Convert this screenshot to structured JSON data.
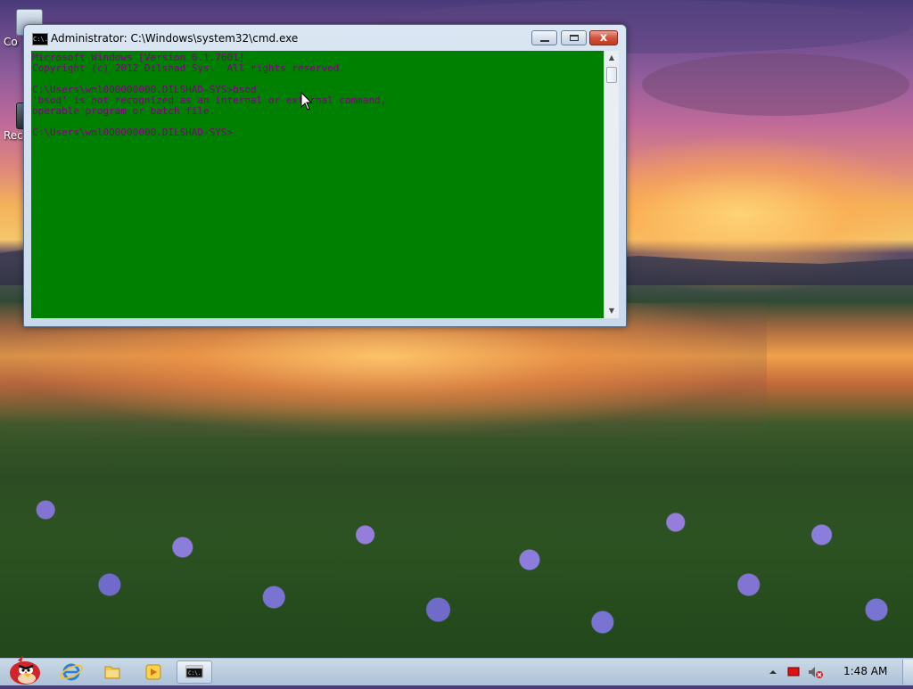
{
  "desktop": {
    "icons": [
      {
        "label": "Co"
      },
      {
        "label": "Rec"
      }
    ]
  },
  "window": {
    "title": "Administrator: C:\\Windows\\system32\\cmd.exe",
    "icon_text": "C:\\.",
    "controls": {
      "minimize": "",
      "maximize": "",
      "close": "x"
    },
    "console_lines": [
      "Microsoft Windows [Version 6.1.7601]",
      "Copyright (c) 2012 Dilshad Sys.  All rights reserved.",
      "",
      "C:\\Users\\wml000000000.DILSHAD-SYS>bsod",
      "'bsod' is not recognized as an internal or external command,",
      "operable program or batch file.",
      "",
      "C:\\Users\\wml000000000.DILSHAD-SYS>"
    ],
    "colors": {
      "console_background": "#008000",
      "console_text": "#800080"
    }
  },
  "taskbar": {
    "clock": "1:48 AM",
    "pinned": [
      {
        "name": "internet-explorer-icon"
      },
      {
        "name": "folder-icon"
      },
      {
        "name": "media-player-icon"
      },
      {
        "name": "cmd-icon",
        "active": true
      }
    ],
    "tray_icons": [
      "show-hidden-icons-icon",
      "flag-icon",
      "volume-muted-icon"
    ]
  }
}
